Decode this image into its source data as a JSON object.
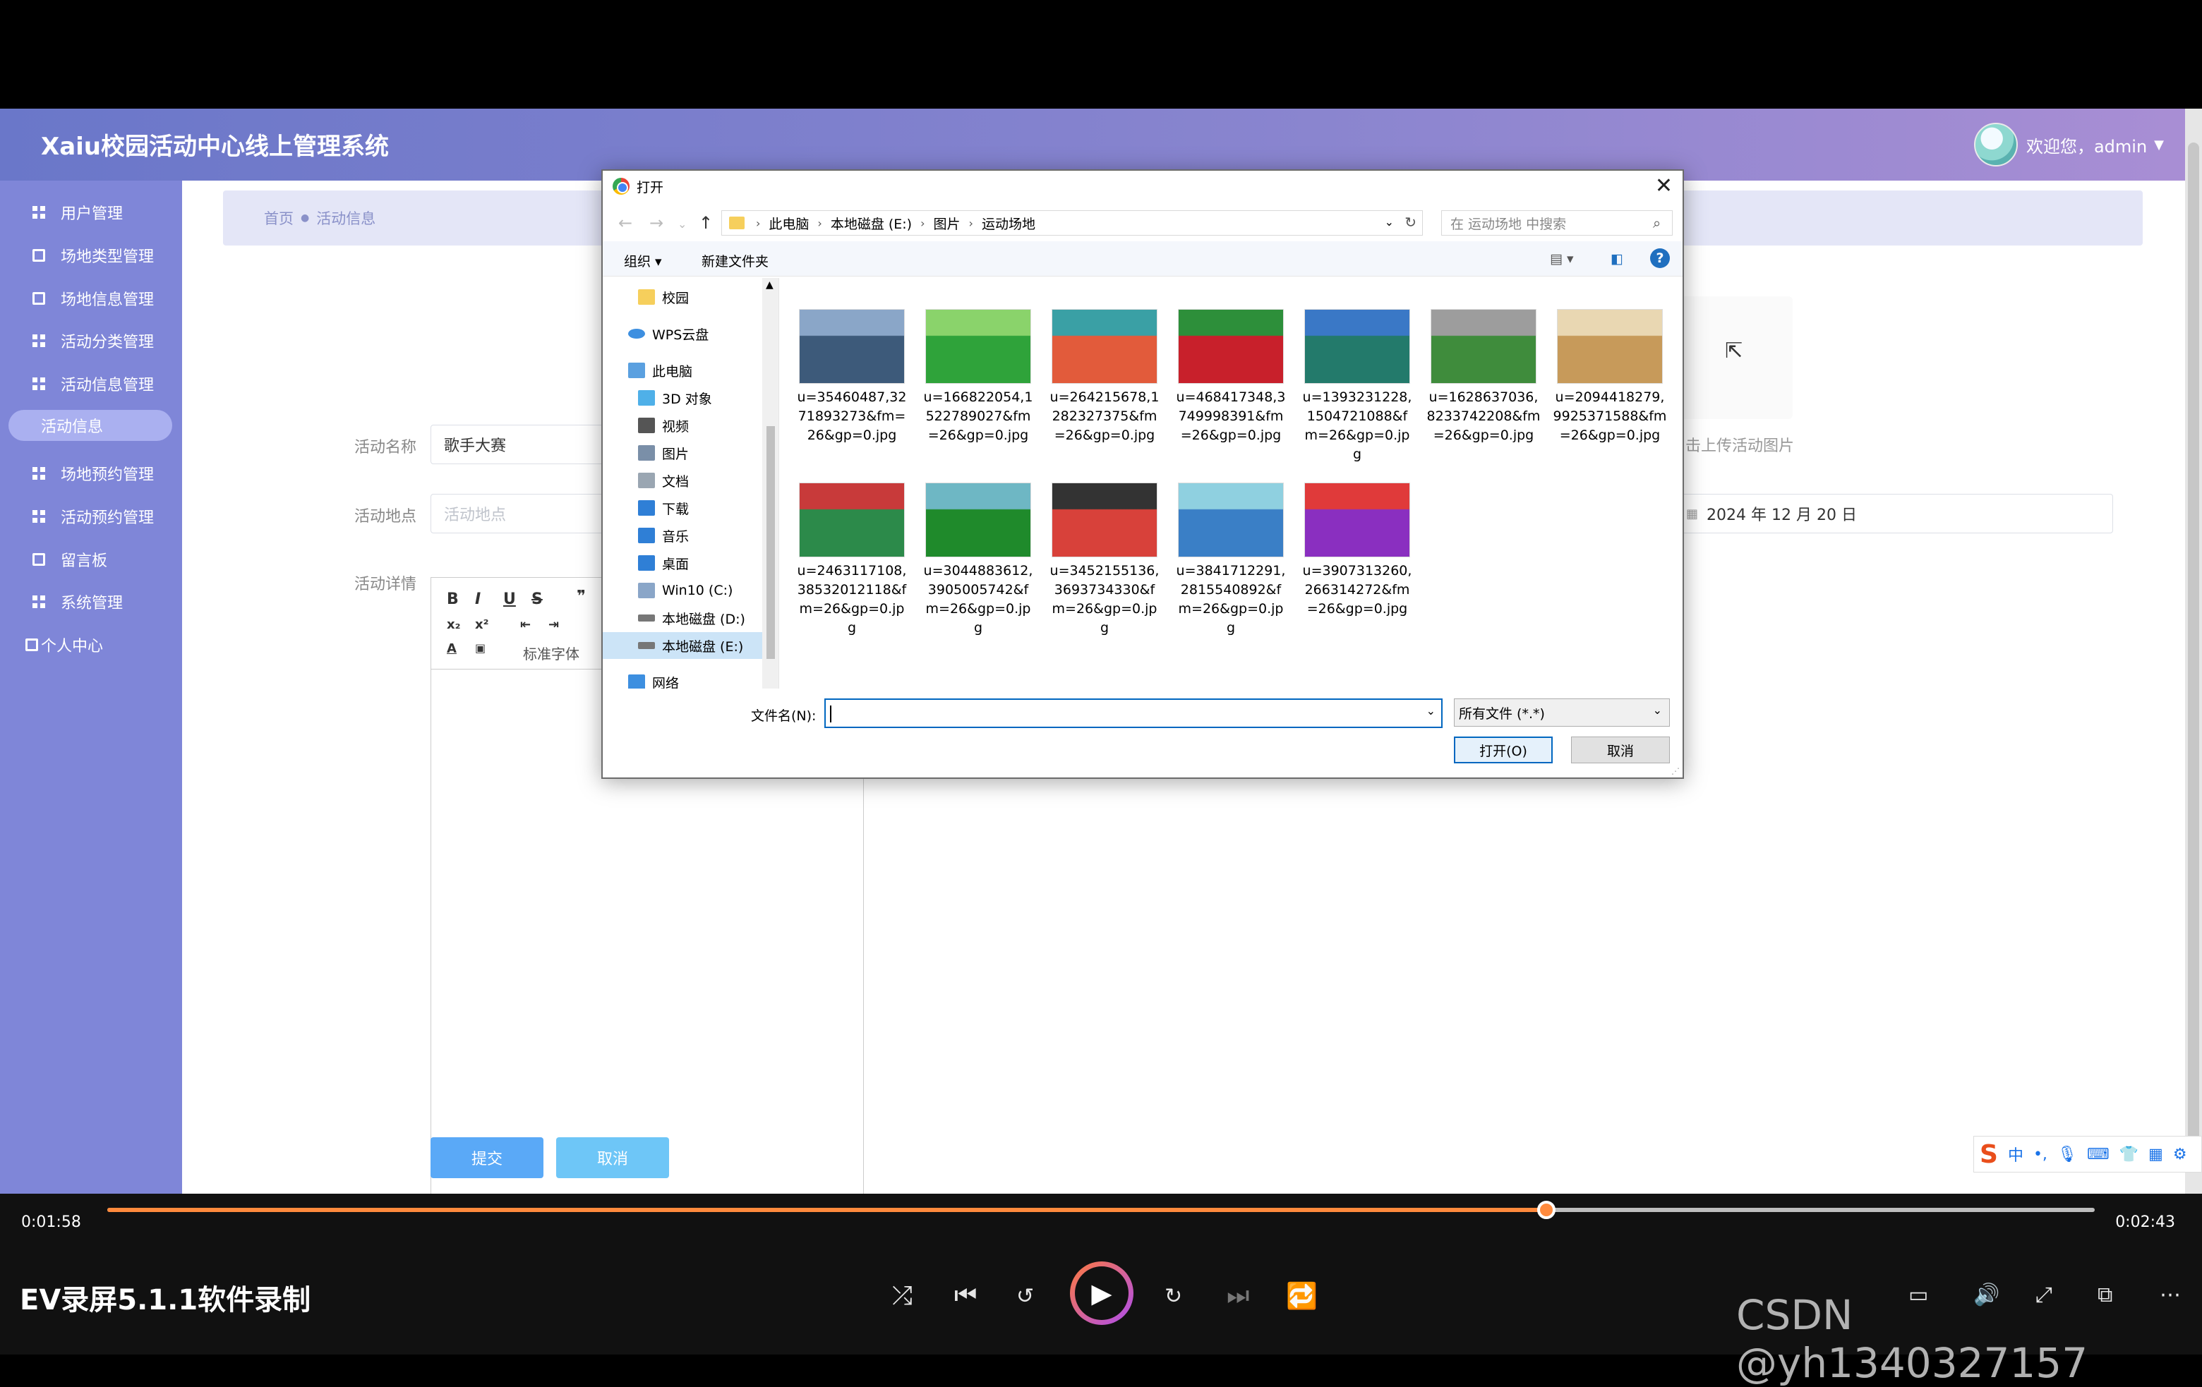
{
  "app": {
    "title": "Xaiu校园活动中心线上管理系统",
    "welcome": "欢迎您，admin"
  },
  "sidebar": {
    "items": [
      {
        "label": "用户管理"
      },
      {
        "label": "场地类型管理"
      },
      {
        "label": "场地信息管理"
      },
      {
        "label": "活动分类管理"
      },
      {
        "label": "活动信息管理"
      },
      {
        "label": "活动信息"
      },
      {
        "label": "场地预约管理"
      },
      {
        "label": "活动预约管理"
      },
      {
        "label": "留言板"
      },
      {
        "label": "系统管理"
      },
      {
        "label": "个人中心"
      }
    ]
  },
  "breadcrumb": {
    "home": "首页",
    "current": "活动信息"
  },
  "form": {
    "name_label": "活动名称",
    "name_value": "歌手大赛",
    "place_label": "活动地点",
    "place_placeholder": "活动地点",
    "detail_label": "活动详情",
    "upload_text": "击上传活动图片",
    "date_value": "2024 年 12 月 20 日",
    "font_select": "标准字体",
    "submit": "提交",
    "cancel": "取消"
  },
  "dialog": {
    "title": "打开",
    "path": [
      "此电脑",
      "本地磁盘 (E:)",
      "图片",
      "运动场地"
    ],
    "search_placeholder": "在 运动场地 中搜索",
    "organize": "组织 ▾",
    "new_folder": "新建文件夹",
    "nav": [
      {
        "label": "校园"
      },
      {
        "label": "WPS云盘"
      },
      {
        "label": "此电脑"
      },
      {
        "label": "3D 对象"
      },
      {
        "label": "视频"
      },
      {
        "label": "图片"
      },
      {
        "label": "文档"
      },
      {
        "label": "下载"
      },
      {
        "label": "音乐"
      },
      {
        "label": "桌面"
      },
      {
        "label": "Win10 (C:)"
      },
      {
        "label": "本地磁盘 (D:)"
      },
      {
        "label": "本地磁盘 (E:)"
      },
      {
        "label": "网络"
      }
    ],
    "files": [
      {
        "l1": "u=35460487,32",
        "l2": "71893273&fm=",
        "l3": "26&gp=0.jpg",
        "l4": "",
        "c1": "#3d5a7a",
        "c2": "#8aa6c8"
      },
      {
        "l1": "u=166822054,1",
        "l2": "522789027&fm",
        "l3": "=26&gp=0.jpg",
        "l4": "",
        "c1": "#2fa33a",
        "c2": "#8ad36b"
      },
      {
        "l1": "u=264215678,1",
        "l2": "282327375&fm",
        "l3": "=26&gp=0.jpg",
        "l4": "",
        "c1": "#e25b3b",
        "c2": "#3aa0a5"
      },
      {
        "l1": "u=468417348,3",
        "l2": "749998391&fm",
        "l3": "=26&gp=0.jpg",
        "l4": "",
        "c1": "#c8202b",
        "c2": "#2d8f3a"
      },
      {
        "l1": "u=1393231228,",
        "l2": "1504721088&f",
        "l3": "m=26&gp=0.jp",
        "l4": "g",
        "c1": "#237a6b",
        "c2": "#3a78c6"
      },
      {
        "l1": "u=1628637036,",
        "l2": "8233742208&fm",
        "l3": "=26&gp=0.jpg",
        "l4": "",
        "c1": "#3f8c3c",
        "c2": "#9d9d9d"
      },
      {
        "l1": "u=2094418279,",
        "l2": "9925371588&fm",
        "l3": "=26&gp=0.jpg",
        "l4": "",
        "c1": "#c79a5a",
        "c2": "#e9d7b2"
      },
      {
        "l1": "u=2463117108,",
        "l2": "38532012118&f",
        "l3": "m=26&gp=0.jp",
        "l4": "g",
        "c1": "#2c8a4a",
        "c2": "#c83a3a"
      },
      {
        "l1": "u=3044883612,",
        "l2": "3905005742&f",
        "l3": "m=26&gp=0.jp",
        "l4": "g",
        "c1": "#1f8a2b",
        "c2": "#6eb7c4"
      },
      {
        "l1": "u=3452155136,",
        "l2": "3693734330&f",
        "l3": "m=26&gp=0.jp",
        "l4": "g",
        "c1": "#d8413a",
        "c2": "#333"
      },
      {
        "l1": "u=3841712291,",
        "l2": "2815540892&f",
        "l3": "m=26&gp=0.jp",
        "l4": "g",
        "c1": "#3a7fc6",
        "c2": "#8fd0e0"
      },
      {
        "l1": "u=3907313260,",
        "l2": "266314272&fm",
        "l3": "=26&gp=0.jpg",
        "l4": "",
        "c1": "#8a2fc0",
        "c2": "#e03a3a"
      }
    ],
    "filename_label": "文件名(N):",
    "filetype": "所有文件 (*.*)",
    "open": "打开(O)",
    "cancel": "取消"
  },
  "ime": {
    "cn": "中"
  },
  "player": {
    "elapsed": "0:01:58",
    "total": "0:02:43",
    "progress": 0.724,
    "title": "EV录屏5.1.1软件录制",
    "watermark": "CSDN @yh1340327157"
  },
  "colors": {
    "accent": "#7f86d8",
    "progress": "#ff8a3d",
    "button": "#66b1ff"
  }
}
